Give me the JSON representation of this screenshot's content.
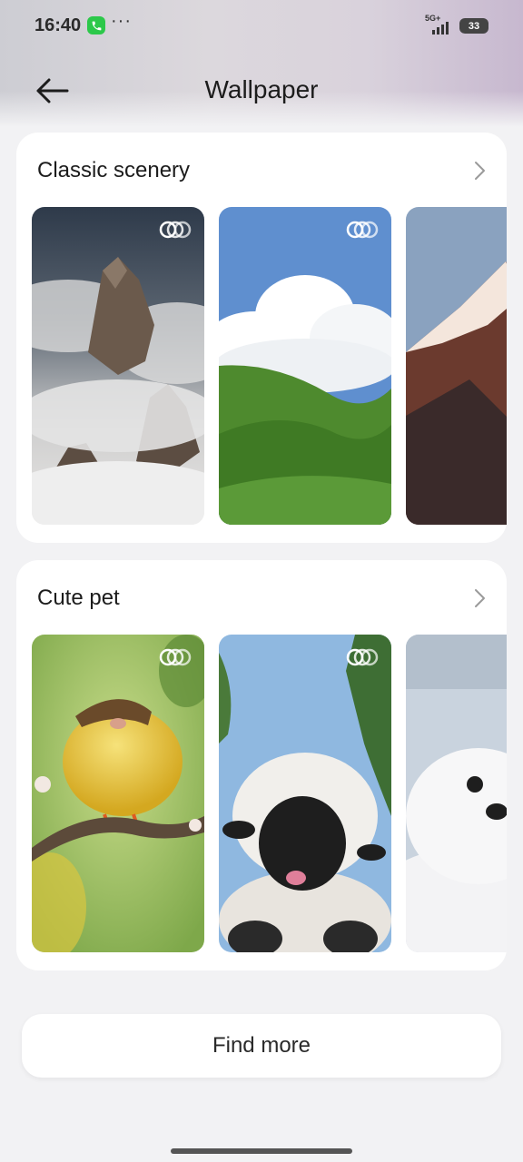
{
  "status_bar": {
    "time": "16:40",
    "more": "···",
    "network": "5G+",
    "battery": "33"
  },
  "header": {
    "title": "Wallpaper",
    "back_icon": "arrow-left-icon"
  },
  "sections": [
    {
      "title": "Classic scenery",
      "more_icon": "chevron-right-icon",
      "items": [
        {
          "subject": "misty rocky peaks",
          "live": true
        },
        {
          "subject": "clouds over green hills",
          "live": true
        },
        {
          "subject": "snowy mountain at sunrise",
          "live": false
        }
      ]
    },
    {
      "title": "Cute pet",
      "more_icon": "chevron-right-icon",
      "items": [
        {
          "subject": "yellow bird on branch",
          "live": true
        },
        {
          "subject": "black-nosed sheep",
          "live": true
        },
        {
          "subject": "baby seal in snow",
          "live": false
        }
      ]
    }
  ],
  "find_more_label": "Find more",
  "colors": {
    "background": "#f2f2f4",
    "card": "#ffffff",
    "call_green": "#2cc84a"
  }
}
